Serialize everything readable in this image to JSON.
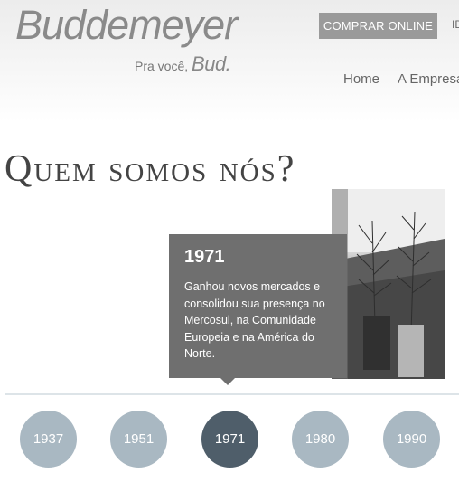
{
  "header": {
    "logo_text": "Buddemeyer",
    "tagline_prefix": "Pra você,",
    "tagline_brand": "Bud.",
    "buy_button": "COMPRAR ONLINE",
    "language_label": "ID"
  },
  "nav": {
    "items": [
      {
        "label": "Home"
      },
      {
        "label": "A Empresa"
      }
    ]
  },
  "main": {
    "title": "Quem somos nós?",
    "popup": {
      "year": "1971",
      "text": "Ganhou novos mercados e consolidou sua presença no Mercosul, na Comunidade Europeia e na América do Norte."
    },
    "timeline": {
      "selected": "1971",
      "years": [
        "1937",
        "1951",
        "1971",
        "1980",
        "1990"
      ]
    }
  }
}
